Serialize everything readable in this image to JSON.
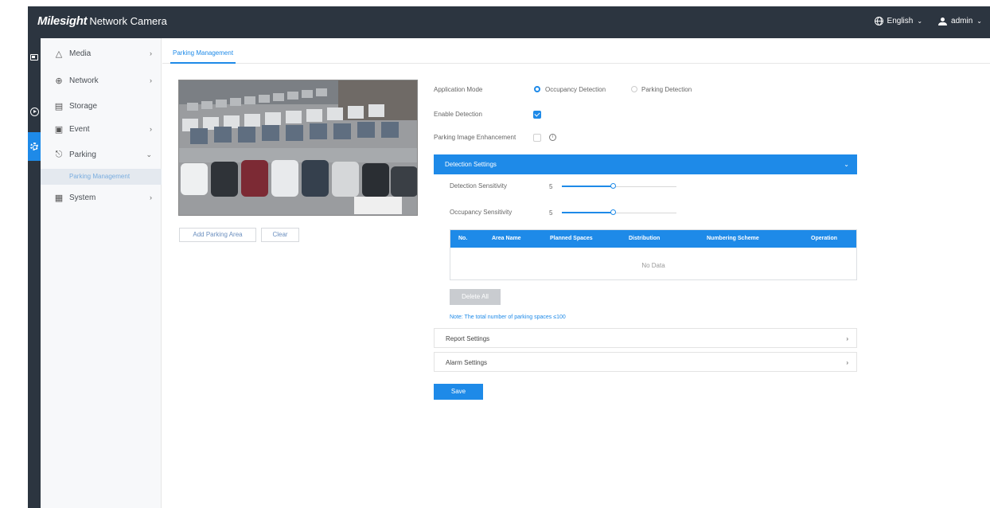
{
  "header": {
    "brand_logo": "Milesight",
    "brand_title": "Network Camera",
    "language": "English",
    "user": "admin"
  },
  "rail": {
    "items": [
      {
        "icon": "live-view-icon"
      },
      {
        "icon": "playback-icon"
      },
      {
        "icon": "settings-icon",
        "active": true
      }
    ]
  },
  "menu": {
    "items": [
      {
        "label": "Media",
        "icon": "media-icon",
        "has_arrow": true
      },
      {
        "label": "Network",
        "icon": "network-icon",
        "has_arrow": true
      },
      {
        "label": "Storage",
        "icon": "storage-icon",
        "has_arrow": false
      },
      {
        "label": "Event",
        "icon": "event-icon",
        "has_arrow": true
      },
      {
        "label": "Parking",
        "icon": "parking-icon",
        "expanded": true
      },
      {
        "label": "System",
        "icon": "system-icon",
        "has_arrow": true
      }
    ],
    "sub_item": "Parking Management"
  },
  "tab": {
    "label": "Parking Management"
  },
  "camera": {
    "add_area_label": "Add Parking Area",
    "clear_label": "Clear"
  },
  "form": {
    "application_mode_label": "Application Mode",
    "mode_options": [
      "Occupancy Detection",
      "Parking Detection"
    ],
    "mode_selected": "Occupancy Detection",
    "enable_detection_label": "Enable Detection",
    "enable_detection": true,
    "enhancement_label": "Parking Image Enhancement",
    "enhancement": false
  },
  "detection": {
    "title": "Detection Settings",
    "detection_sensitivity_label": "Detection Sensitivity",
    "detection_sensitivity": "5",
    "occupancy_sensitivity_label": "Occupancy Sensitivity",
    "occupancy_sensitivity": "5",
    "table_headers": [
      "No.",
      "Area Name",
      "Planned Spaces",
      "Distribution",
      "Numbering Scheme",
      "Operation"
    ],
    "no_data": "No Data",
    "delete_all_label": "Delete All",
    "note": "Note: The total number of parking spaces ≤100"
  },
  "panels": {
    "report": "Report Settings",
    "alarm": "Alarm Settings"
  },
  "save_label": "Save",
  "colors": {
    "accent": "#1e8ae8",
    "topbar": "#2c3540"
  }
}
